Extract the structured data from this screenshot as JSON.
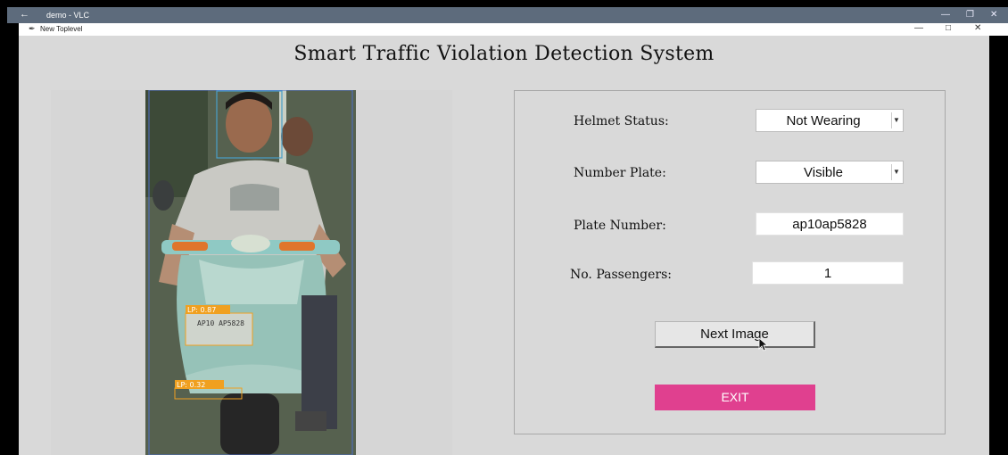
{
  "vlc_window": {
    "back_icon": "arrow-left-icon",
    "title": "demo - VLC",
    "controls": [
      "minimize-icon",
      "restore-icon",
      "close-icon"
    ]
  },
  "toplevel": {
    "title": "New Toplevel",
    "icon": "feather-icon"
  },
  "app": {
    "title": "Smart Traffic Violation Detection System"
  },
  "detections": {
    "plate_box_1": "LP: 0.87",
    "plate_box_2": "LP: 0.32",
    "plate_text": "AP10 AP5828"
  },
  "form": {
    "helmet_label": "Helmet Status:",
    "helmet_value": "Not Wearing",
    "plate_label": "Number Plate:",
    "plate_value": "Visible",
    "plate_number_label": "Plate Number:",
    "plate_number_value": "ap10ap5828",
    "passengers_label": "No. Passengers:",
    "passengers_value": "1"
  },
  "buttons": {
    "next": "Next Image",
    "exit": "EXIT"
  },
  "colors": {
    "exit_button": "#e0408f",
    "background": "#d9d9d9",
    "detection_box_label": "#f0a020"
  }
}
